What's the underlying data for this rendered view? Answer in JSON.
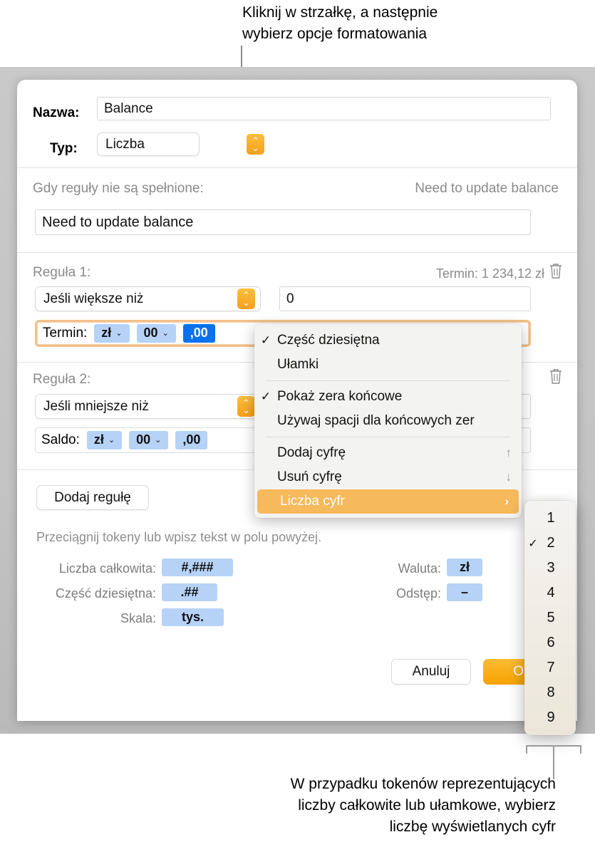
{
  "callouts": {
    "top": "Kliknij w strzałkę, a następnie\nwybierz opcje formatowania",
    "bottom": "W przypadku tokenów reprezentujących\nliczby całkowite lub ułamkowe, wybierz\nliczbę wyświetlanych cyfr"
  },
  "dialog": {
    "name_label": "Nazwa:",
    "name_value": "Balance",
    "type_label": "Typ:",
    "type_value": "Liczba",
    "fallback_label": "Gdy reguły nie są spełnione:",
    "fallback_preview": "Need to update balance",
    "fallback_value": "Need to update balance",
    "rules": [
      {
        "title": "Reguła 1:",
        "preview": "Termin: 1 234,12 zł",
        "condition": "Jeśli większe niż",
        "threshold": "0",
        "token_label": "Termin:",
        "tokens": [
          {
            "text": "zł",
            "caret": "⌄",
            "selected": false
          },
          {
            "text": "00",
            "caret": "⌄",
            "selected": false
          },
          {
            "text": ",00",
            "caret": "",
            "selected": true
          }
        ]
      },
      {
        "title": "Reguła 2:",
        "condition": "Jeśli mniejsze niż",
        "token_label": "Saldo:",
        "tokens": [
          {
            "text": "zł",
            "caret": "⌄",
            "selected": false
          },
          {
            "text": "00",
            "caret": "⌄",
            "selected": false
          },
          {
            "text": ",00",
            "caret": "",
            "selected": false
          }
        ]
      }
    ],
    "add_rule_label": "Dodaj regułę",
    "drag_hint": "Przeciągnij tokeny lub wpisz tekst w polu powyżej.",
    "token_palette": {
      "integer_label": "Liczba całkowita:",
      "integer_token": "#,###",
      "decimal_label": "Część dziesiętna:",
      "decimal_token": ".##",
      "scale_label": "Skala:",
      "scale_token": "tys.",
      "currency_label": "Waluta:",
      "currency_token": "zł",
      "spacing_label": "Odstęp:",
      "spacing_token": "–"
    },
    "cancel_label": "Anuluj",
    "ok_label": "OK"
  },
  "context_menu": {
    "items": [
      {
        "label": "Część dziesiętna",
        "checked": true,
        "glyph": ""
      },
      {
        "label": "Ułamki",
        "checked": false,
        "glyph": ""
      },
      {
        "separator": true
      },
      {
        "label": "Pokaż zera końcowe",
        "checked": true,
        "glyph": ""
      },
      {
        "label": "Używaj spacji dla końcowych zer",
        "checked": false,
        "glyph": ""
      },
      {
        "separator": true
      },
      {
        "label": "Dodaj cyfrę",
        "checked": false,
        "glyph": "↑"
      },
      {
        "label": "Usuń cyfrę",
        "checked": false,
        "glyph": "↓"
      },
      {
        "label": "Liczba cyfr",
        "checked": false,
        "glyph": "›",
        "highlighted": true
      }
    ]
  },
  "digit_submenu": {
    "items": [
      {
        "label": "1",
        "checked": false
      },
      {
        "label": "2",
        "checked": true
      },
      {
        "label": "3",
        "checked": false
      },
      {
        "label": "4",
        "checked": false
      },
      {
        "label": "5",
        "checked": false
      },
      {
        "label": "6",
        "checked": false
      },
      {
        "label": "7",
        "checked": false
      },
      {
        "label": "8",
        "checked": false
      },
      {
        "label": "9",
        "checked": false
      }
    ]
  },
  "colors": {
    "accent_orange": "#f5a623",
    "highlight": "#f6b95b",
    "token_blue": "#b6d2f7",
    "token_selected": "#0a72ef",
    "focus_ring": "#f3c08a"
  },
  "icons": {
    "stepper": "chevron-up-down-icon",
    "trash": "trash-icon",
    "check": "✓",
    "submenu_arrow": "›"
  }
}
